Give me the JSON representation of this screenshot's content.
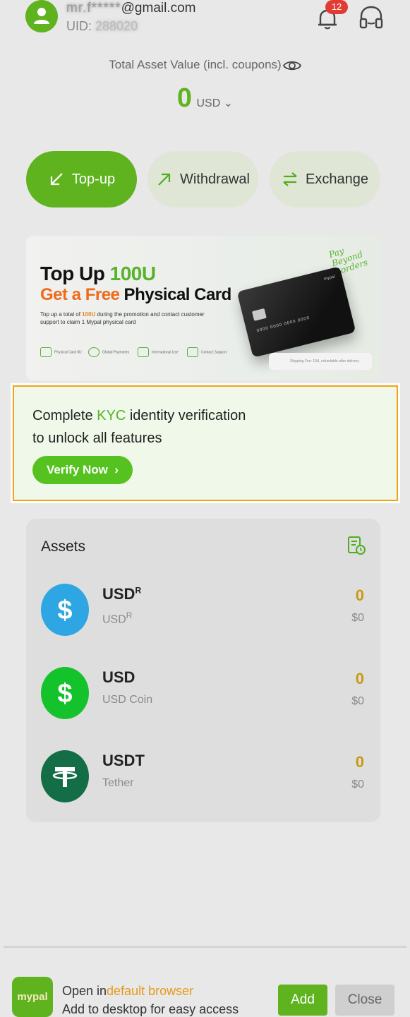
{
  "account": {
    "email_masked": "mr.f*****",
    "email_domain": "@gmail.com",
    "uid_label": "UID:",
    "uid_value": "288020",
    "notification_count": "12"
  },
  "balance": {
    "label": "Total Asset Value (incl. coupons)",
    "value": "0",
    "currency": "USD",
    "currency_chevron": "⌄"
  },
  "actions": {
    "topup": "Top-up",
    "withdrawal": "Withdrawal",
    "exchange": "Exchange"
  },
  "banner": {
    "line1_a": "Top Up ",
    "line1_b": "100U",
    "line2_a": "Get a Free",
    "line2_b": " Physical Card",
    "body_a": "Top up a total of ",
    "body_b": "100U",
    "body_c": " during the promotion and contact customer support to claim 1 Mypal physical card",
    "script": "Pay Beyond Borders",
    "features": [
      "Physical Card 0U",
      "Global Payments",
      "International Use",
      "Contact Support"
    ],
    "shipping": "Shipping Fee: 10U, refundable after delivery",
    "card_brand": "mypal",
    "card_number": "0000 0000 0000 0000"
  },
  "kyc": {
    "line1_a": "Complete ",
    "line1_b": "KYC",
    "line1_c": " identity verification",
    "line2": "to unlock all features",
    "button": "Verify Now",
    "button_chevron": "›"
  },
  "assets": {
    "title": "Assets",
    "items": [
      {
        "symbol": "USD",
        "sup": "R",
        "name": "USD",
        "name_sup": "R",
        "balance": "0",
        "usd": "$0",
        "color": "#2ea6e3"
      },
      {
        "symbol": "USD",
        "sup": "",
        "name": "USD Coin",
        "name_sup": "",
        "balance": "0",
        "usd": "$0",
        "color": "#14c22c"
      },
      {
        "symbol": "USDT",
        "sup": "",
        "name": "Tether",
        "name_sup": "",
        "balance": "0",
        "usd": "$0",
        "color": "#136d47"
      }
    ]
  },
  "install_bar": {
    "app_name": "mypal",
    "line1_a": "Open in",
    "line1_b": "default browser",
    "line2": "Add to desktop for easy access",
    "add": "Add",
    "close": "Close"
  }
}
